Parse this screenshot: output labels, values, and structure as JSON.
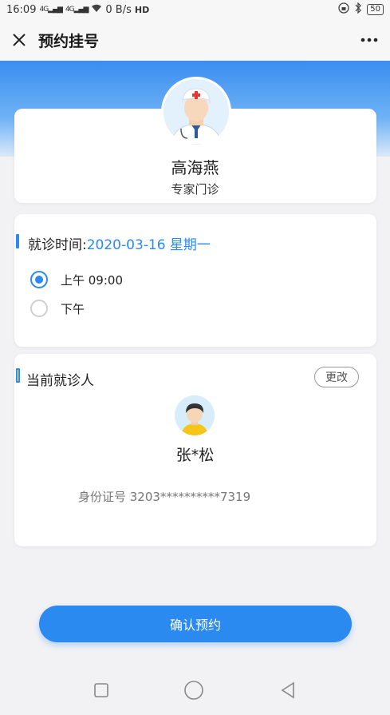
{
  "status_bar": {
    "time": "16:09",
    "signal1": "4G",
    "signal2": "4G",
    "speed": "0 B/s",
    "hd": "HD",
    "battery": "50"
  },
  "nav": {
    "title": "预约挂号"
  },
  "doctor": {
    "name": "高海燕",
    "department": "专家门诊"
  },
  "visit_time": {
    "label": "就诊时间:",
    "date": "2020-03-16 星期一",
    "options": [
      {
        "label": "上午 09:00",
        "selected": true
      },
      {
        "label": "下午",
        "selected": false
      }
    ]
  },
  "patient": {
    "label": "当前就诊人",
    "change_label": "更改",
    "name": "张*松",
    "id_text": "身份证号 3203**********7319"
  },
  "confirm_label": "确认预约",
  "colors": {
    "accent": "#2b8af0",
    "banner_top": "#3a8ef0"
  }
}
